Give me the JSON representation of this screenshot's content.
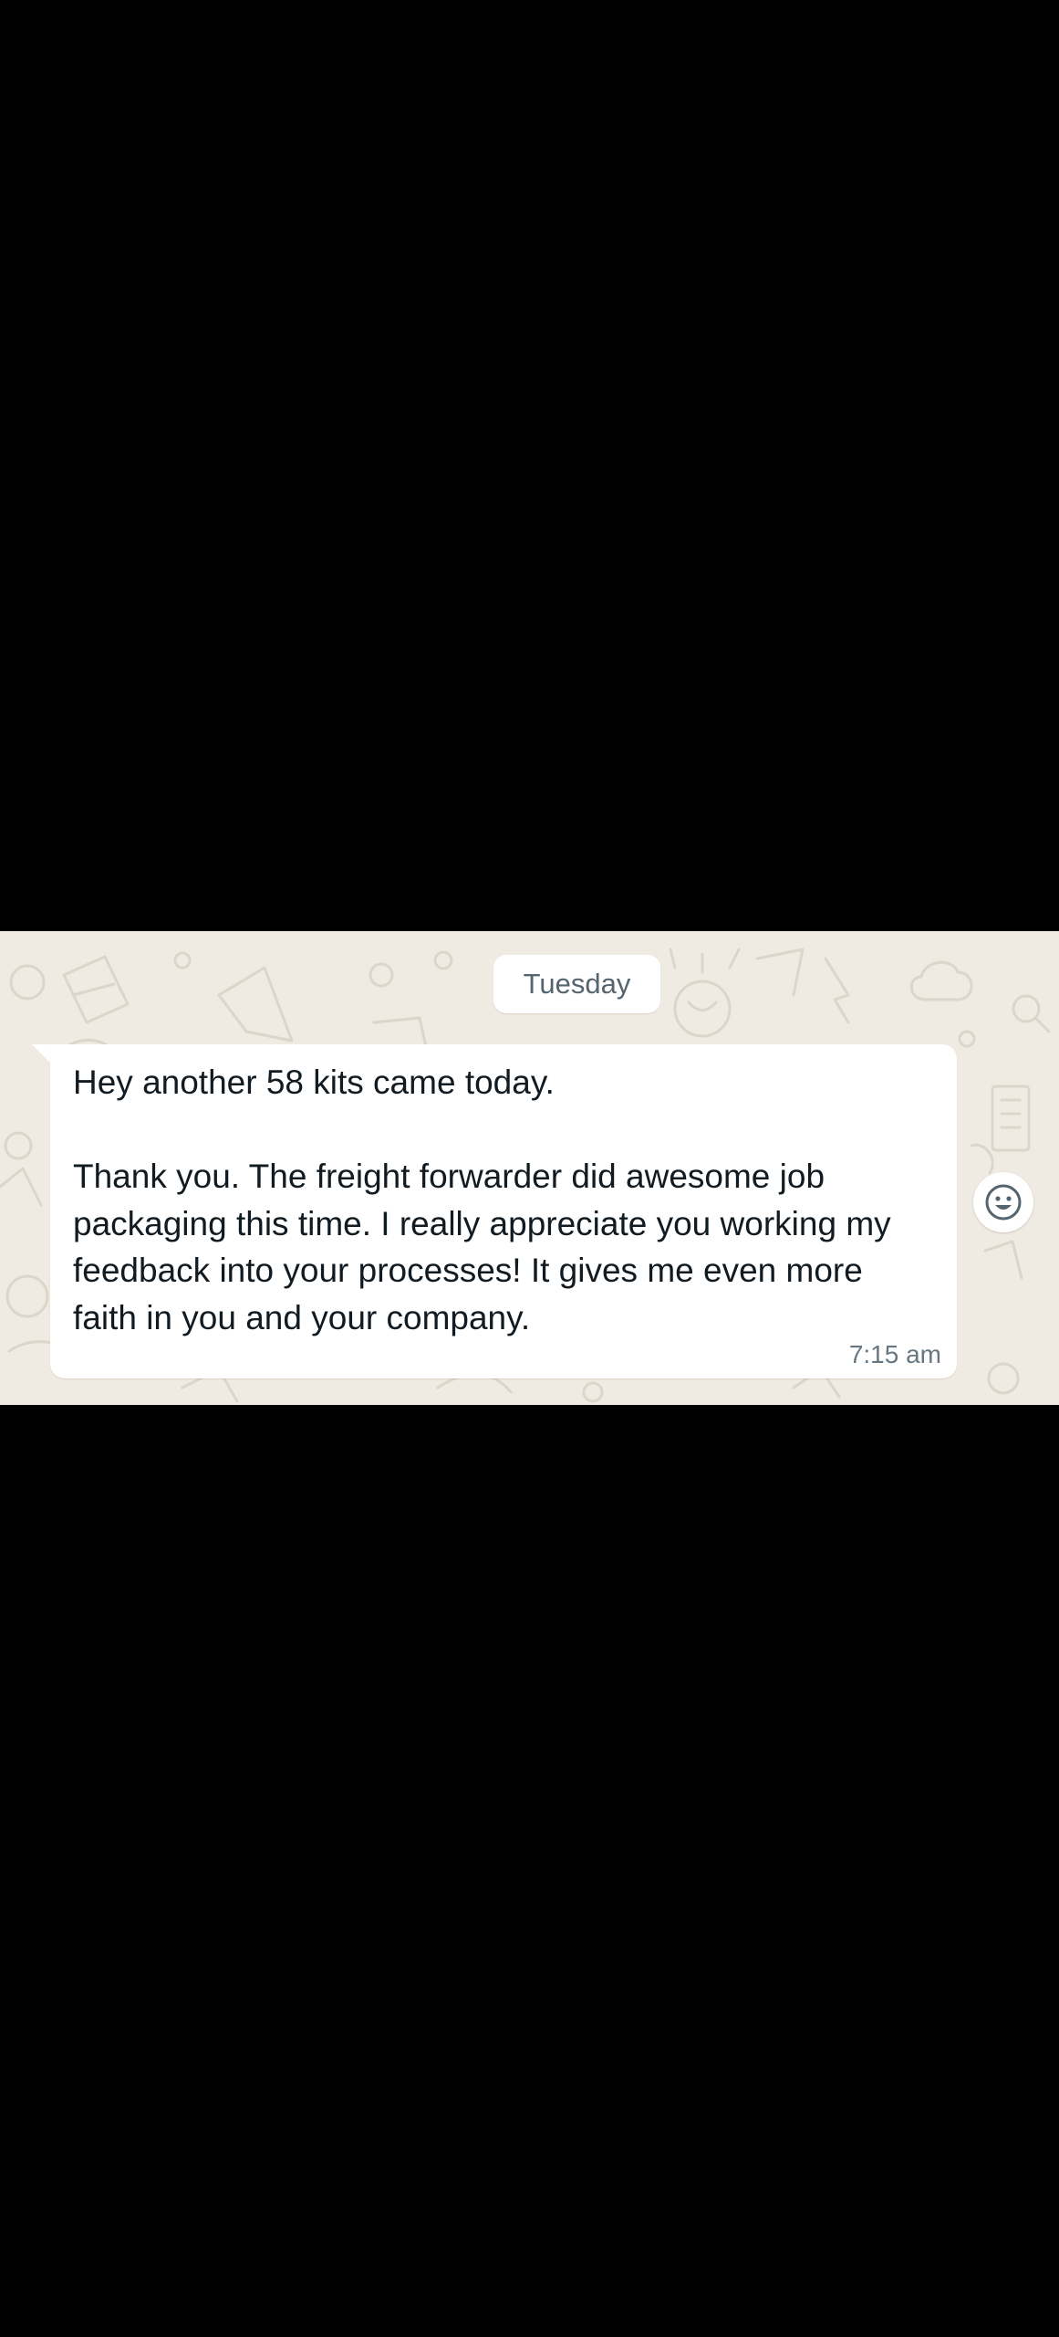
{
  "chat": {
    "date_chip": "Tuesday",
    "message": {
      "lines": [
        "Hey another 58 kits came today.",
        "",
        "Thank you. The freight forwarder did awesome job",
        "packaging this time. I really appreciate you working my",
        "feedback into your processes! It gives me even more",
        "faith in you and your company."
      ],
      "time": "7:15 am"
    },
    "reaction_button": {
      "icon": "smiley-icon"
    }
  },
  "colors": {
    "chat_background": "#efeae2",
    "bubble": "#ffffff",
    "text": "#111b21",
    "meta_text": "#667781",
    "date_chip_text": "#54656f"
  }
}
